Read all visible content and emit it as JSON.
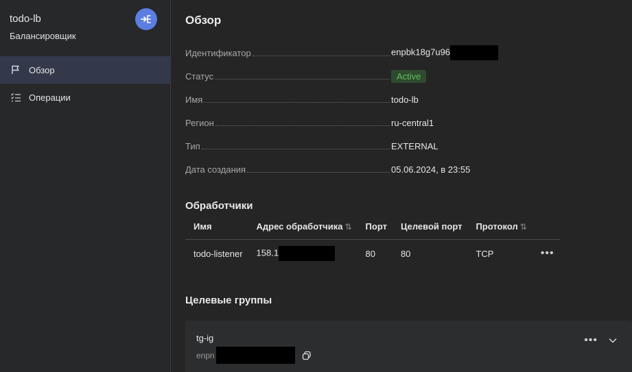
{
  "sidebar": {
    "title": "todo-lb",
    "subtitle": "Балансировщик",
    "items": [
      {
        "label": "Обзор",
        "icon": "flag-icon",
        "active": true
      },
      {
        "label": "Операции",
        "icon": "checklist-icon",
        "active": false
      }
    ]
  },
  "overview": {
    "title": "Обзор",
    "props": {
      "id": {
        "key": "Идентификатор",
        "value": "enpbk18g7u96"
      },
      "status": {
        "key": "Статус",
        "value": "Active"
      },
      "name": {
        "key": "Имя",
        "value": "todo-lb"
      },
      "region": {
        "key": "Регион",
        "value": "ru-central1"
      },
      "type": {
        "key": "Тип",
        "value": "EXTERNAL"
      },
      "created": {
        "key": "Дата создания",
        "value": "05.06.2024, в 23:55"
      }
    }
  },
  "listeners": {
    "title": "Обработчики",
    "columns": [
      "Имя",
      "Адрес обработчика",
      "Порт",
      "Целевой порт",
      "Протокол"
    ],
    "rows": [
      {
        "name": "todo-listener",
        "address": "158.1",
        "port": "80",
        "target_port": "80",
        "protocol": "TCP"
      }
    ]
  },
  "target_groups": {
    "title": "Целевые группы",
    "items": [
      {
        "name": "tg-ig",
        "id": "enpn"
      }
    ]
  },
  "colors": {
    "accent": "#5b7ee0",
    "active_nav": "#33394a",
    "status_active": "#5fbf5f"
  }
}
